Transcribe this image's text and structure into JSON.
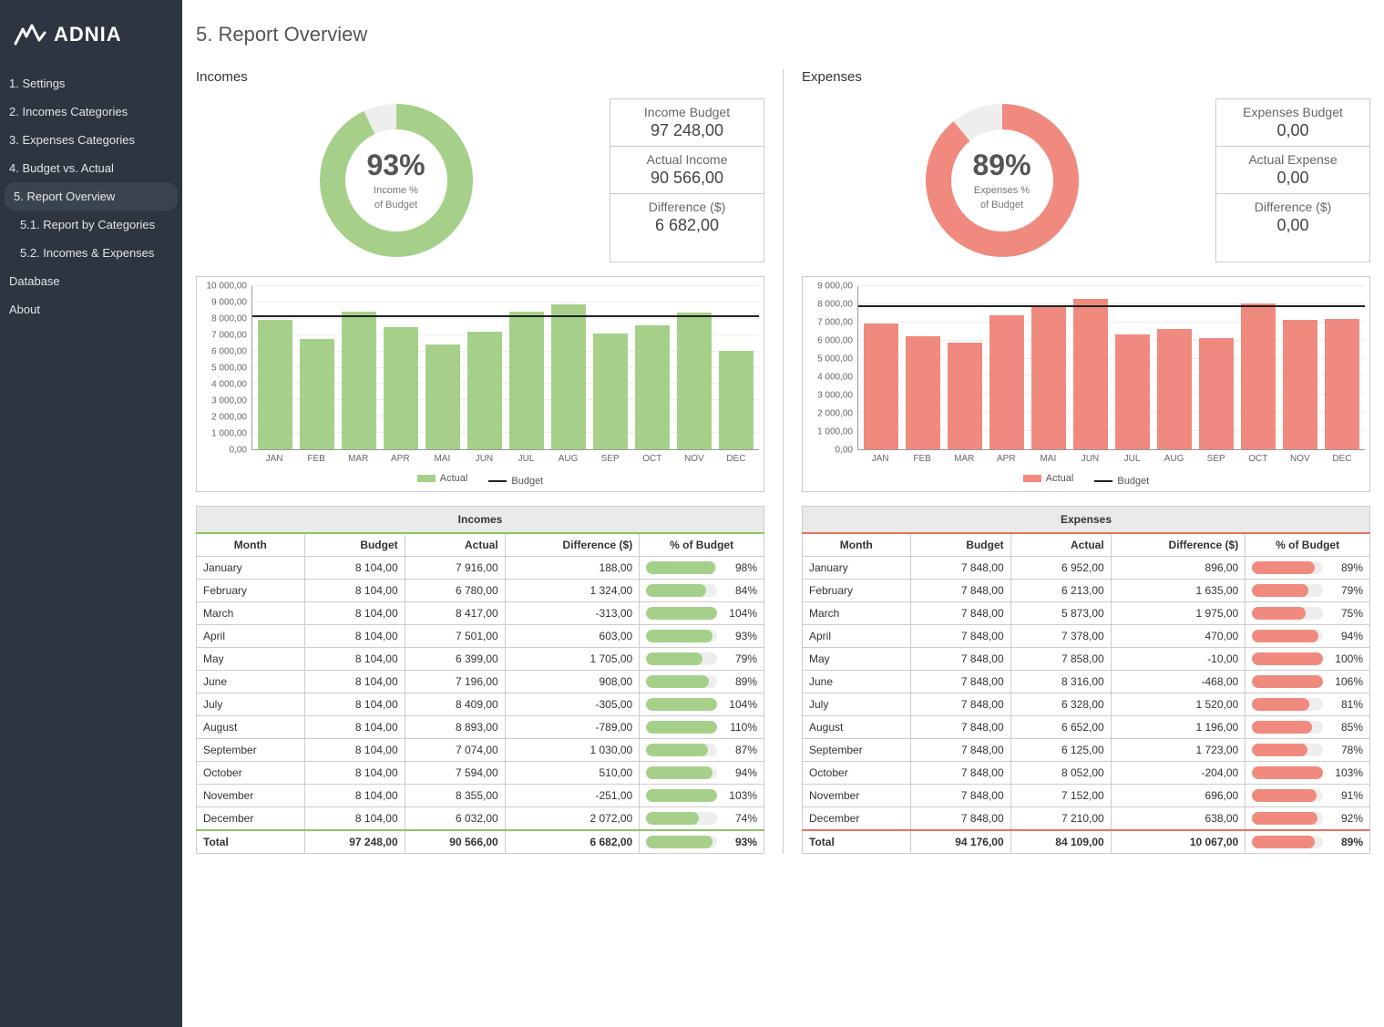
{
  "brand": "ADNIA",
  "page_title": "5. Report Overview",
  "nav": [
    {
      "label": "1. Settings",
      "active": false,
      "sub": false
    },
    {
      "label": "2. Incomes Categories",
      "active": false,
      "sub": false
    },
    {
      "label": "3. Expenses Categories",
      "active": false,
      "sub": false
    },
    {
      "label": "4. Budget vs. Actual",
      "active": false,
      "sub": false
    },
    {
      "label": "5. Report Overview",
      "active": true,
      "sub": false
    },
    {
      "label": "5.1. Report by Categories",
      "active": false,
      "sub": true
    },
    {
      "label": "5.2. Incomes & Expenses",
      "active": false,
      "sub": true
    },
    {
      "label": "Database",
      "active": false,
      "sub": false
    },
    {
      "label": "About",
      "active": false,
      "sub": false
    }
  ],
  "incomes": {
    "title": "Incomes",
    "donut_pct": "93%",
    "donut_pct_num": 93,
    "donut_label_1": "Income %",
    "donut_label_2": "of Budget",
    "summary": [
      {
        "label": "Income Budget",
        "value": "97 248,00"
      },
      {
        "label": "Actual Income",
        "value": "90 566,00"
      },
      {
        "label": "Difference ($)",
        "value": "6 682,00"
      }
    ],
    "table_title": "Incomes",
    "headers": [
      "Month",
      "Budget",
      "Actual",
      "Difference ($)",
      "% of Budget"
    ],
    "rows": [
      {
        "month": "January",
        "budget": "8 104,00",
        "actual": "7 916,00",
        "diff": "188,00",
        "pct": "98%",
        "pct_num": 98
      },
      {
        "month": "February",
        "budget": "8 104,00",
        "actual": "6 780,00",
        "diff": "1 324,00",
        "pct": "84%",
        "pct_num": 84
      },
      {
        "month": "March",
        "budget": "8 104,00",
        "actual": "8 417,00",
        "diff": "-313,00",
        "pct": "104%",
        "pct_num": 104
      },
      {
        "month": "April",
        "budget": "8 104,00",
        "actual": "7 501,00",
        "diff": "603,00",
        "pct": "93%",
        "pct_num": 93
      },
      {
        "month": "May",
        "budget": "8 104,00",
        "actual": "6 399,00",
        "diff": "1 705,00",
        "pct": "79%",
        "pct_num": 79
      },
      {
        "month": "June",
        "budget": "8 104,00",
        "actual": "7 196,00",
        "diff": "908,00",
        "pct": "89%",
        "pct_num": 89
      },
      {
        "month": "July",
        "budget": "8 104,00",
        "actual": "8 409,00",
        "diff": "-305,00",
        "pct": "104%",
        "pct_num": 104
      },
      {
        "month": "August",
        "budget": "8 104,00",
        "actual": "8 893,00",
        "diff": "-789,00",
        "pct": "110%",
        "pct_num": 110
      },
      {
        "month": "September",
        "budget": "8 104,00",
        "actual": "7 074,00",
        "diff": "1 030,00",
        "pct": "87%",
        "pct_num": 87
      },
      {
        "month": "October",
        "budget": "8 104,00",
        "actual": "7 594,00",
        "diff": "510,00",
        "pct": "94%",
        "pct_num": 94
      },
      {
        "month": "November",
        "budget": "8 104,00",
        "actual": "8 355,00",
        "diff": "-251,00",
        "pct": "103%",
        "pct_num": 103
      },
      {
        "month": "December",
        "budget": "8 104,00",
        "actual": "6 032,00",
        "diff": "2 072,00",
        "pct": "74%",
        "pct_num": 74
      }
    ],
    "total": {
      "month": "Total",
      "budget": "97 248,00",
      "actual": "90 566,00",
      "diff": "6 682,00",
      "pct": "93%",
      "pct_num": 93
    }
  },
  "expenses": {
    "title": "Expenses",
    "donut_pct": "89%",
    "donut_pct_num": 89,
    "donut_label_1": "Expenses %",
    "donut_label_2": "of Budget",
    "summary": [
      {
        "label": "Expenses Budget",
        "value": "0,00"
      },
      {
        "label": "Actual Expense",
        "value": "0,00"
      },
      {
        "label": "Difference ($)",
        "value": "0,00"
      }
    ],
    "table_title": "Expenses",
    "headers": [
      "Month",
      "Budget",
      "Actual",
      "Difference ($)",
      "% of Budget"
    ],
    "rows": [
      {
        "month": "January",
        "budget": "7 848,00",
        "actual": "6 952,00",
        "diff": "896,00",
        "pct": "89%",
        "pct_num": 89
      },
      {
        "month": "February",
        "budget": "7 848,00",
        "actual": "6 213,00",
        "diff": "1 635,00",
        "pct": "79%",
        "pct_num": 79
      },
      {
        "month": "March",
        "budget": "7 848,00",
        "actual": "5 873,00",
        "diff": "1 975,00",
        "pct": "75%",
        "pct_num": 75
      },
      {
        "month": "April",
        "budget": "7 848,00",
        "actual": "7 378,00",
        "diff": "470,00",
        "pct": "94%",
        "pct_num": 94
      },
      {
        "month": "May",
        "budget": "7 848,00",
        "actual": "7 858,00",
        "diff": "-10,00",
        "pct": "100%",
        "pct_num": 100
      },
      {
        "month": "June",
        "budget": "7 848,00",
        "actual": "8 316,00",
        "diff": "-468,00",
        "pct": "106%",
        "pct_num": 106
      },
      {
        "month": "July",
        "budget": "7 848,00",
        "actual": "6 328,00",
        "diff": "1 520,00",
        "pct": "81%",
        "pct_num": 81
      },
      {
        "month": "August",
        "budget": "7 848,00",
        "actual": "6 652,00",
        "diff": "1 196,00",
        "pct": "85%",
        "pct_num": 85
      },
      {
        "month": "September",
        "budget": "7 848,00",
        "actual": "6 125,00",
        "diff": "1 723,00",
        "pct": "78%",
        "pct_num": 78
      },
      {
        "month": "October",
        "budget": "7 848,00",
        "actual": "8 052,00",
        "diff": "-204,00",
        "pct": "103%",
        "pct_num": 103
      },
      {
        "month": "November",
        "budget": "7 848,00",
        "actual": "7 152,00",
        "diff": "696,00",
        "pct": "91%",
        "pct_num": 91
      },
      {
        "month": "December",
        "budget": "7 848,00",
        "actual": "7 210,00",
        "diff": "638,00",
        "pct": "92%",
        "pct_num": 92
      }
    ],
    "total": {
      "month": "Total",
      "budget": "94 176,00",
      "actual": "84 109,00",
      "diff": "10 067,00",
      "pct": "89%",
      "pct_num": 89
    }
  },
  "legend": {
    "actual": "Actual",
    "budget": "Budget"
  },
  "chart_data": [
    {
      "type": "bar",
      "title": "Incomes monthly",
      "categories": [
        "JAN",
        "FEB",
        "MAR",
        "APR",
        "MAI",
        "JUN",
        "JUL",
        "AUG",
        "SEP",
        "OCT",
        "NOV",
        "DEC"
      ],
      "series": [
        {
          "name": "Actual",
          "values": [
            7916,
            6780,
            8417,
            7501,
            6399,
            7196,
            8409,
            8893,
            7074,
            7594,
            8355,
            6032
          ],
          "color": "#a6d08a"
        },
        {
          "name": "Budget",
          "values": [
            8104,
            8104,
            8104,
            8104,
            8104,
            8104,
            8104,
            8104,
            8104,
            8104,
            8104,
            8104
          ],
          "color": "#222222",
          "style": "line"
        }
      ],
      "ylim": [
        0,
        10000
      ],
      "y_ticks": [
        "0,00",
        "1 000,00",
        "2 000,00",
        "3 000,00",
        "4 000,00",
        "5 000,00",
        "6 000,00",
        "7 000,00",
        "8 000,00",
        "9 000,00",
        "10 000,00"
      ]
    },
    {
      "type": "bar",
      "title": "Expenses monthly",
      "categories": [
        "JAN",
        "FEB",
        "MAR",
        "APR",
        "MAI",
        "JUN",
        "JUL",
        "AUG",
        "SEP",
        "OCT",
        "NOV",
        "DEC"
      ],
      "series": [
        {
          "name": "Actual",
          "values": [
            6952,
            6213,
            5873,
            7378,
            7858,
            8316,
            6328,
            6652,
            6125,
            8052,
            7152,
            7210
          ],
          "color": "#f08a7e"
        },
        {
          "name": "Budget",
          "values": [
            7848,
            7848,
            7848,
            7848,
            7848,
            7848,
            7848,
            7848,
            7848,
            7848,
            7848,
            7848
          ],
          "color": "#222222",
          "style": "line"
        }
      ],
      "ylim": [
        0,
        9000
      ],
      "y_ticks": [
        "0,00",
        "1 000,00",
        "2 000,00",
        "3 000,00",
        "4 000,00",
        "5 000,00",
        "6 000,00",
        "7 000,00",
        "8 000,00",
        "9 000,00"
      ]
    }
  ]
}
